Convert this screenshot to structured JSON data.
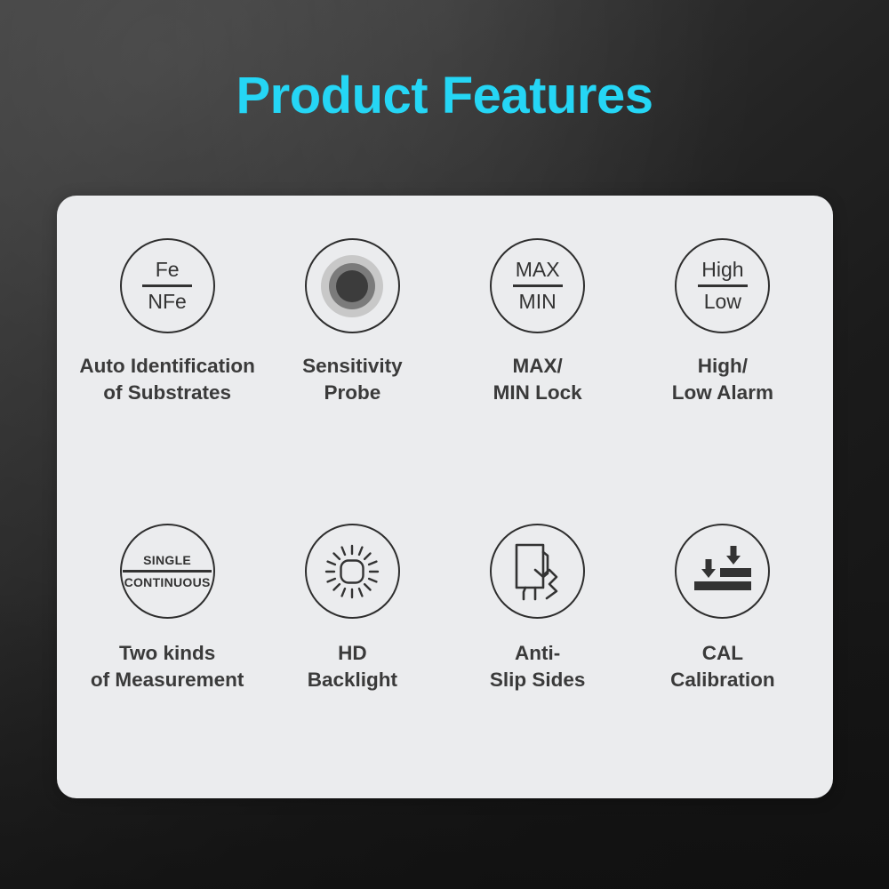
{
  "header": {
    "title": "Product Features",
    "title_color": "#25d6f5"
  },
  "card": {
    "background_color": "#ebecee"
  },
  "background": {
    "color_top_left": "#3f3f3f",
    "color_bottom_right": "#151515"
  },
  "features": [
    {
      "id": "auto-identification",
      "icon": "fe-nfe-icon",
      "icon_text_top": "Fe",
      "icon_text_bottom": "NFe",
      "label": "Auto Identification\nof Substrates"
    },
    {
      "id": "sensitivity-probe",
      "icon": "probe-target-icon",
      "label": "Sensitivity\nProbe"
    },
    {
      "id": "max-min-lock",
      "icon": "max-min-icon",
      "icon_text_top": "MAX",
      "icon_text_bottom": "MIN",
      "label": "MAX/\nMIN Lock"
    },
    {
      "id": "high-low-alarm",
      "icon": "high-low-icon",
      "icon_text_top": "High",
      "icon_text_bottom": "Low",
      "label": "High/\nLow Alarm"
    },
    {
      "id": "two-kinds-measurement",
      "icon": "single-continuous-icon",
      "icon_text_top": "SINGLE",
      "icon_text_bottom": "CONTINUOUS",
      "label": "Two kinds\nof Measurement"
    },
    {
      "id": "hd-backlight",
      "icon": "sun-brightness-icon",
      "label": "HD\nBacklight"
    },
    {
      "id": "anti-slip-sides",
      "icon": "hand-grip-device-icon",
      "label": "Anti-\nSlip Sides"
    },
    {
      "id": "cal-calibration",
      "icon": "calibration-arrows-icon",
      "label": "CAL\nCalibration"
    }
  ]
}
